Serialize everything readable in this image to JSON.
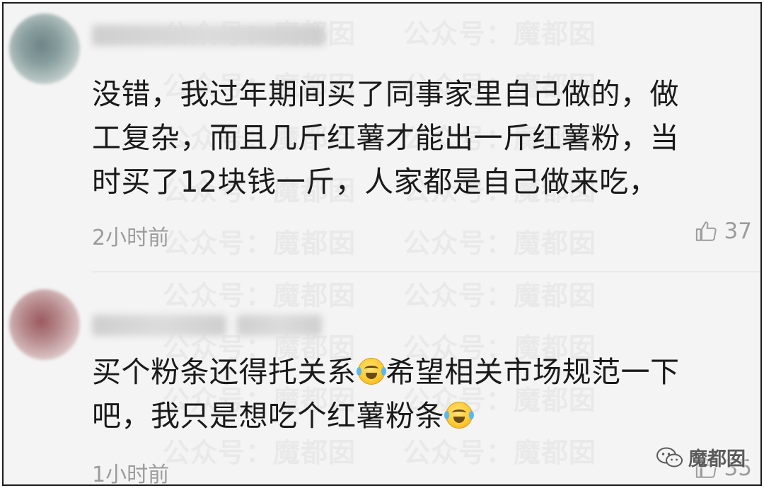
{
  "watermark": "公众号：魔都囡",
  "comments": [
    {
      "lines": [
        "没错，我过年期间买了同事家里自己做的，做",
        "工复杂，而且几斤红薯才能出一斤红薯粉，当",
        "时买了12块钱一斤，人家都是自己做来吃，"
      ],
      "time": "2小时前",
      "likes": "37"
    },
    {
      "line1_a": "买个粉条还得托关系",
      "line1_b": "希望相关市场规范一下",
      "line2_a": "吧，我只是想吃个红薯粉条",
      "emoji_icon": "laugh-cry-emoji",
      "time": "1小时前",
      "likes": "35"
    }
  ],
  "brand": {
    "name": "魔都囡",
    "icon": "wechat-icon"
  }
}
